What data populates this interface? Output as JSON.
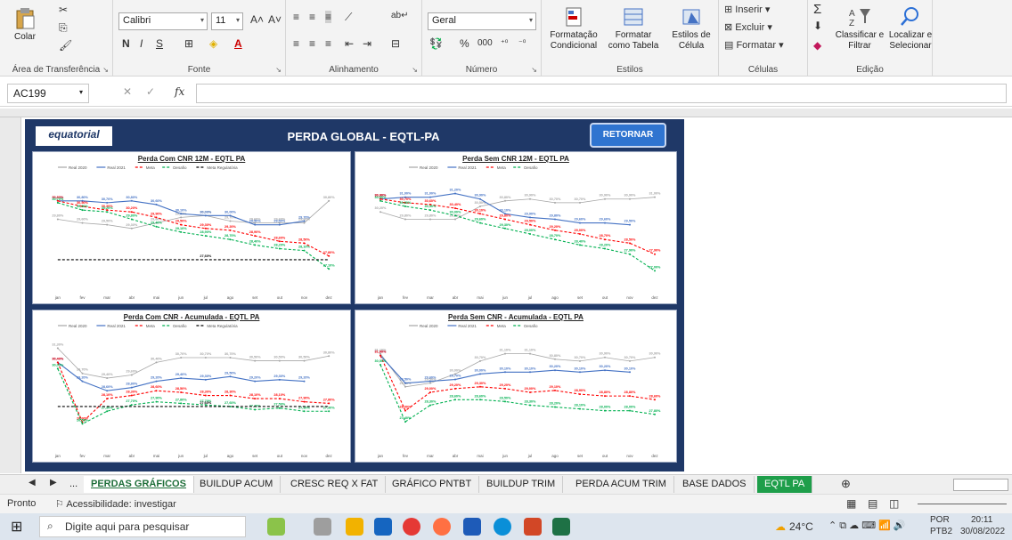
{
  "ribbon": {
    "clipboard": {
      "paste": "Colar",
      "label": "Área de Transferência"
    },
    "font": {
      "name": "Calibri",
      "size": "11",
      "bold": "N",
      "italic": "I",
      "underline": "S",
      "label": "Fonte"
    },
    "alignment": {
      "label": "Alinhamento"
    },
    "number": {
      "format": "Geral",
      "percent": "%",
      "thousands": "000",
      "label": "Número"
    },
    "styles": {
      "conditional": "Formatação Condicional",
      "as_table": "Formatar como Tabela",
      "cell_styles": "Estilos de Célula",
      "label": "Estilos"
    },
    "cells": {
      "insert": "Inserir",
      "delete": "Excluir",
      "format": "Formatar",
      "label": "Células"
    },
    "editing": {
      "sort": "Classificar e Filtrar",
      "find": "Localizar e Selecionar",
      "label": "Edição"
    }
  },
  "formula_bar": {
    "name_box": "AC199",
    "fx": "fx"
  },
  "dashboard": {
    "logo": "equatorial",
    "title": "PERDA GLOBAL - EQTL-PA",
    "return_button": "RETORNAR"
  },
  "colors": {
    "real2020": "#a6a6a6",
    "real2021": "#4472c4",
    "meta": "#ff0000",
    "desafio": "#00b050",
    "regulatoria": "#000000"
  },
  "months": [
    "jan",
    "fev",
    "mar",
    "abr",
    "mai",
    "jun",
    "jul",
    "ago",
    "set",
    "out",
    "nov",
    "dez"
  ],
  "chart_data": [
    {
      "type": "line",
      "title": "Perda Com CNR 12M - EQTL PA",
      "ylim": [
        26,
        32
      ],
      "series": [
        {
          "name": "Real 2020",
          "values": [
            29.8,
            29.6,
            29.5,
            29.3,
            29.6,
            29.9,
            30.0,
            29.7,
            29.6,
            29.6,
            29.6,
            30.8
          ]
        },
        {
          "name": "Real 2021",
          "values": [
            30.8,
            30.8,
            30.7,
            30.8,
            30.6,
            30.1,
            30.0,
            30.0,
            29.5,
            29.5,
            29.7,
            null
          ]
        },
        {
          "name": "Meta",
          "values": [
            30.8,
            30.5,
            30.3,
            30.2,
            29.9,
            29.5,
            29.3,
            29.2,
            28.9,
            28.6,
            28.5,
            27.8
          ]
        },
        {
          "name": "Desafio",
          "values": [
            30.7,
            30.3,
            30.2,
            29.8,
            29.4,
            29.1,
            28.9,
            28.7,
            28.4,
            28.2,
            28.1,
            27.1
          ]
        },
        {
          "name": "Meta Regulatória",
          "values": [
            27.6,
            27.6,
            27.6,
            27.6,
            27.6,
            27.6,
            27.6,
            27.6,
            27.6,
            27.6,
            27.6,
            27.6
          ]
        }
      ]
    },
    {
      "type": "line",
      "title": "Perda Sem CNR 12M - EQTL PA",
      "ylim": [
        26,
        32
      ],
      "series": [
        {
          "name": "Real 2020",
          "values": [
            30.2,
            29.8,
            29.8,
            29.8,
            30.5,
            30.8,
            30.9,
            30.7,
            30.7,
            30.9,
            30.9,
            31.0
          ]
        },
        {
          "name": "Real 2021",
          "values": [
            30.9,
            31.0,
            31.0,
            31.2,
            30.9,
            30.1,
            29.9,
            29.8,
            29.6,
            29.6,
            29.5,
            null
          ]
        },
        {
          "name": "Meta",
          "values": [
            30.9,
            30.7,
            30.6,
            30.4,
            30.1,
            29.8,
            29.5,
            29.2,
            29.0,
            28.7,
            28.5,
            27.9
          ]
        },
        {
          "name": "Desafio",
          "values": [
            30.8,
            30.5,
            30.3,
            30.0,
            29.6,
            29.3,
            29.0,
            28.7,
            28.4,
            28.2,
            27.9,
            27.0
          ]
        }
      ]
    },
    {
      "type": "line",
      "title": "Perda Com CNR - Acumulada - EQTL PA",
      "ylim": [
        25,
        32
      ],
      "series": [
        {
          "name": "Real 2020",
          "values": [
            31.3,
            29.7,
            29.4,
            29.6,
            30.4,
            30.7,
            30.7,
            30.7,
            30.5,
            30.5,
            30.5,
            30.8
          ]
        },
        {
          "name": "Real 2021",
          "values": [
            30.4,
            29.2,
            28.6,
            28.8,
            29.2,
            29.4,
            29.3,
            29.5,
            29.2,
            29.3,
            29.2,
            null
          ]
        },
        {
          "name": "Meta",
          "values": [
            30.4,
            26.6,
            28.1,
            28.3,
            28.6,
            28.5,
            28.3,
            28.3,
            28.1,
            28.1,
            27.9,
            27.8
          ]
        },
        {
          "name": "Desafio",
          "values": [
            30.0,
            26.5,
            27.3,
            27.7,
            27.9,
            27.8,
            27.7,
            27.6,
            27.4,
            27.5,
            27.3,
            27.3
          ]
        },
        {
          "name": "Meta Regulatória",
          "values": [
            27.6,
            27.6,
            27.6,
            27.6,
            27.6,
            27.6,
            27.6,
            27.6,
            27.6,
            27.6,
            27.6,
            27.6
          ]
        }
      ]
    },
    {
      "type": "line",
      "title": "Perda Sem CNR - Acumulada - EQTL PA",
      "ylim": [
        26,
        32
      ],
      "series": [
        {
          "name": "Real 2020",
          "values": [
            31.1,
            29.3,
            29.5,
            30.0,
            30.7,
            31.1,
            31.1,
            30.8,
            30.7,
            30.9,
            30.7,
            30.9
          ]
        },
        {
          "name": "Real 2021",
          "values": [
            31.0,
            29.5,
            29.6,
            29.7,
            30.0,
            30.1,
            30.1,
            30.2,
            30.1,
            30.2,
            30.1,
            null
          ]
        },
        {
          "name": "Meta",
          "values": [
            31.0,
            28.0,
            29.0,
            29.2,
            29.3,
            29.2,
            29.0,
            29.1,
            28.9,
            28.8,
            28.8,
            28.6
          ]
        },
        {
          "name": "Desafio",
          "values": [
            30.5,
            27.4,
            28.3,
            28.6,
            28.6,
            28.5,
            28.3,
            28.2,
            28.1,
            28.0,
            28.0,
            27.8
          ]
        }
      ]
    }
  ],
  "tabs": [
    {
      "label": "..."
    },
    {
      "label": "PERDAS GRÁFICOS"
    },
    {
      "label": "BUILDUP ACUM"
    },
    {
      "label": "CRESC REQ X FAT"
    },
    {
      "label": "GRÁFICO PNTBT"
    },
    {
      "label": "BUILDUP TRIM"
    },
    {
      "label": "PERDA ACUM TRIM"
    },
    {
      "label": "BASE DADOS"
    },
    {
      "label": "EQTL PA"
    }
  ],
  "status": {
    "ready": "Pronto",
    "accessibility": "Acessibilidade: investigar"
  },
  "taskbar": {
    "search_placeholder": "Digite aqui para pesquisar",
    "temperature": "24°C",
    "language": "POR",
    "layout": "PTB2",
    "time": "20:11",
    "date": "30/08/2022"
  }
}
